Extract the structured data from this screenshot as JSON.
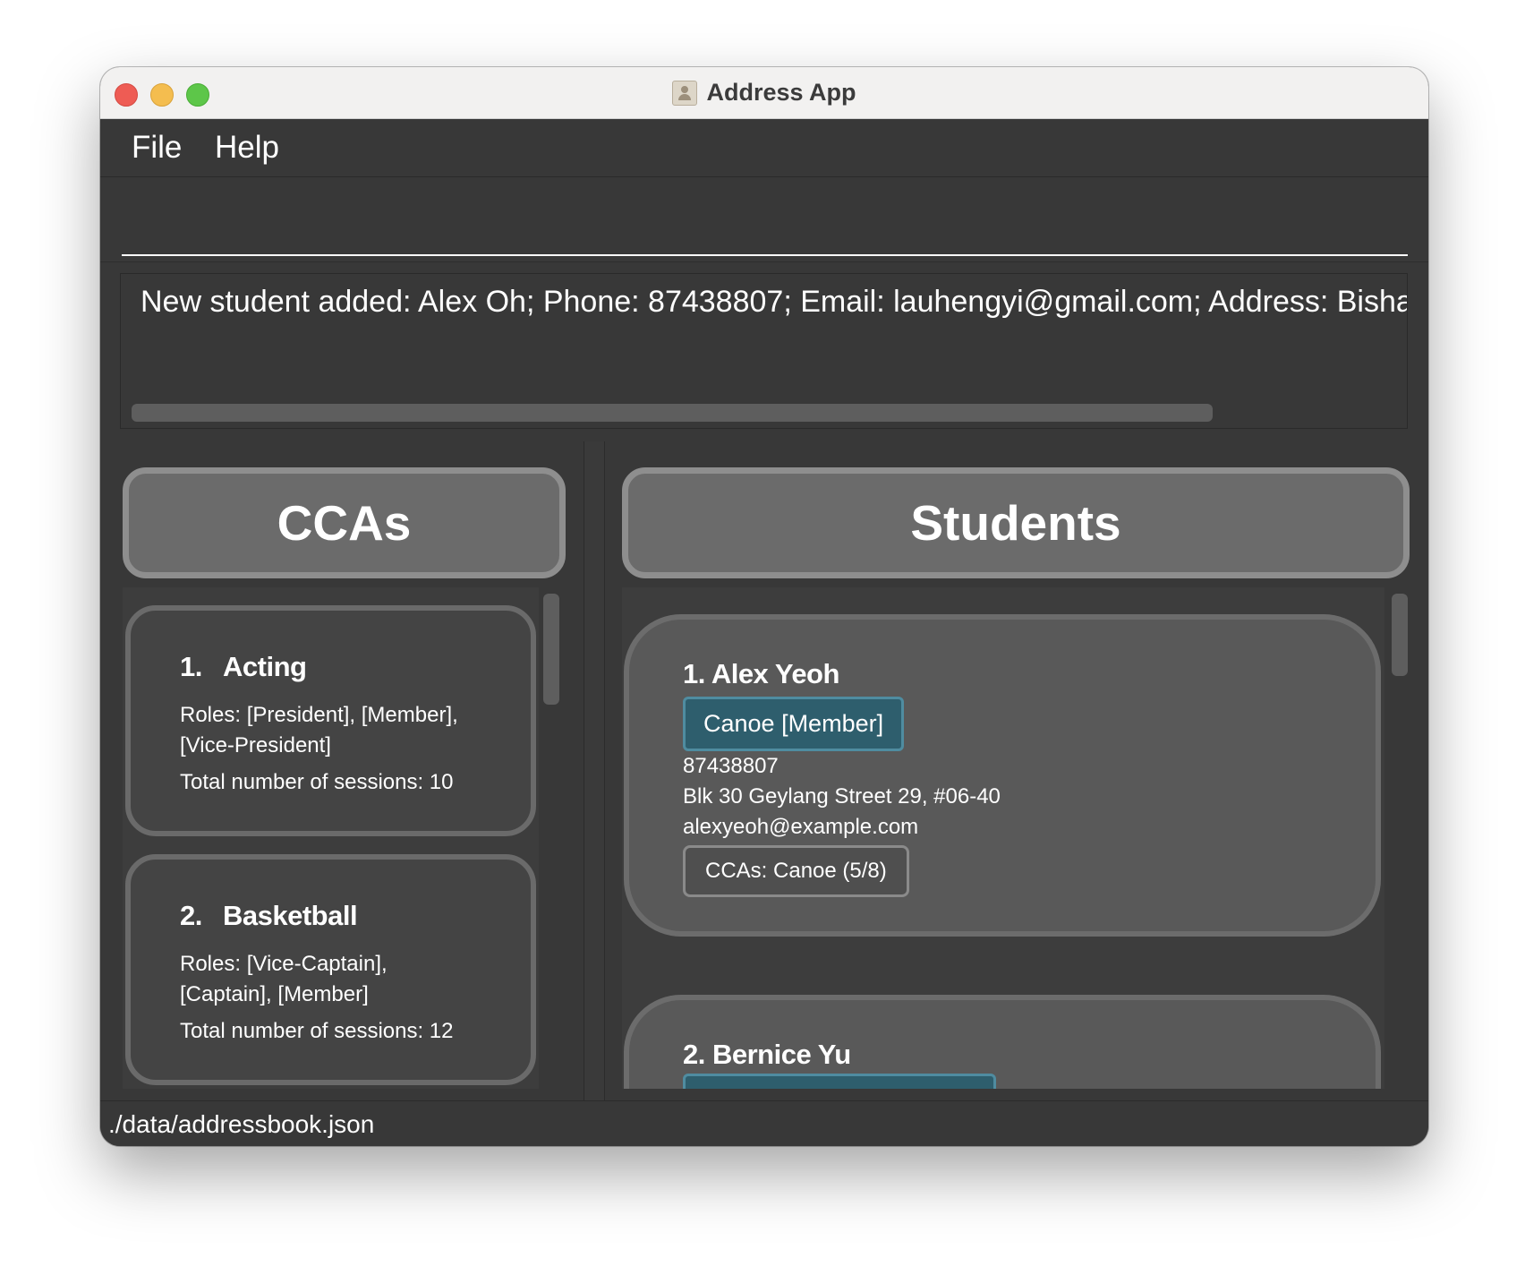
{
  "window": {
    "title": "Address App",
    "icon": "contact-card-icon"
  },
  "menu": {
    "file": "File",
    "help": "Help"
  },
  "command": {
    "value": "",
    "placeholder": ""
  },
  "result": {
    "text": "New student added: Alex Oh; Phone: 87438807; Email: lauhengyi@gmail.com; Address: Bishan; C"
  },
  "ccas": {
    "header": "CCAs",
    "items": [
      {
        "index": "1.",
        "name": "Acting",
        "roles": "Roles: [President], [Member], [Vice-President]",
        "sessions": "Total number of sessions: 10"
      },
      {
        "index": "2.",
        "name": "Basketball",
        "roles": "Roles: [Vice-Captain], [Captain], [Member]",
        "sessions": "Total number of sessions: 12"
      }
    ]
  },
  "students": {
    "header": "Students",
    "items": [
      {
        "name": "1. Alex Yeoh",
        "tag": "Canoe [Member]",
        "phone": "87438807",
        "address": "Blk 30 Geylang Street 29, #06-40",
        "email": "alexyeoh@example.com",
        "ccas": "CCAs: Canoe (5/8)"
      },
      {
        "name": "2. Bernice Yu"
      }
    ]
  },
  "status": {
    "path": "./data/addressbook.json"
  },
  "colors": {
    "background": "#383838",
    "tag": "#2e5e6d",
    "tag_border": "#4f8ca0",
    "card_cca": "#444444",
    "card_student": "#595959",
    "header": "#6b6b6b"
  }
}
